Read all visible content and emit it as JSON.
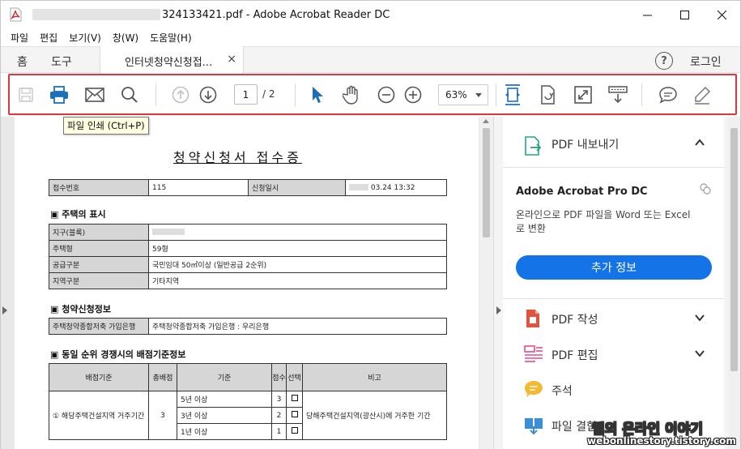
{
  "window": {
    "title_suffix": "324133421.pdf - Adobe Acrobat Reader DC",
    "minimize": "—",
    "maximize": "☐",
    "close": "✕"
  },
  "menu": [
    "파일",
    "편집",
    "보기(V)",
    "창(W)",
    "도움말(H)"
  ],
  "tabs": {
    "home": "홈",
    "tools": "도구",
    "document": "인터넷청약신청접...",
    "close": "×",
    "help": "?",
    "login": "로그인"
  },
  "toolbar": {
    "page_current": "1",
    "page_total": "/ 2",
    "zoom": "63%",
    "icons": [
      "save-icon",
      "print-icon",
      "email-icon",
      "search-icon",
      "arrow-up-icon",
      "arrow-down-icon",
      "select-cursor-icon",
      "hand-tool-icon",
      "zoom-out-icon",
      "zoom-in-icon",
      "fit-page-icon",
      "rotate-icon",
      "full-screen-icon",
      "scroll-mode-icon",
      "comment-icon",
      "sign-icon"
    ],
    "accent": "#e0363b"
  },
  "tooltip": "파일 인쇄 (Ctrl+P)",
  "document": {
    "title": "청약신청서 접수증",
    "receipt": {
      "label_no": "접수번호",
      "value_no": "115",
      "label_date": "신청일시",
      "value_date": "03.24 13:32"
    },
    "section1": "▣ 주택의 표시",
    "housing": [
      {
        "label": "지구(블록)",
        "value": ""
      },
      {
        "label": "주택형",
        "value": "59형"
      },
      {
        "label": "공급구분",
        "value": "국민임대 50㎡이상 (일반공급 2순위)"
      },
      {
        "label": "지역구분",
        "value": "기타지역"
      }
    ],
    "section2": "▣ 청약신청정보",
    "bank": {
      "label": "주택청약종합저축 가입은행",
      "value": "주택청약종합저축 가입은행 : 우리은행"
    },
    "section3": "▣ 동일 순위 경쟁시의 배점기준정보",
    "score_headers": [
      "배점기준",
      "총배점",
      "기준",
      "점수",
      "선택",
      "비고"
    ],
    "score_row_label": "① 해당주택건설지역 거주기간",
    "score_total": "3",
    "score_rows": [
      {
        "criterion": "5년 이상",
        "points": "3"
      },
      {
        "criterion": "3년 이상",
        "points": "2"
      },
      {
        "criterion": "1년 이상",
        "points": "1"
      }
    ],
    "score_note": "당해주택건설지역(광산시)에 거주한 기간"
  },
  "right_pane": {
    "export": "PDF 내보내기",
    "product": "Adobe Acrobat Pro DC",
    "desc": "온라인으로 PDF 파일을 Word 또는 Excel로 변환",
    "more_button": "추가 정보",
    "tools": [
      {
        "label": "PDF 작성",
        "icon": "create-pdf-icon",
        "color": "#e0533d"
      },
      {
        "label": "PDF 편집",
        "icon": "edit-pdf-icon",
        "color": "#e54d8a"
      },
      {
        "label": "주석",
        "icon": "comment-tool-icon",
        "color": "#f5b833"
      },
      {
        "label": "파일 결합",
        "icon": "combine-files-icon",
        "color": "#3a8fd8"
      }
    ],
    "accent": "#1473e6"
  },
  "watermark": {
    "main": "웹의 온라인 이야기",
    "sub": "webonlinestory.tistory.com"
  }
}
